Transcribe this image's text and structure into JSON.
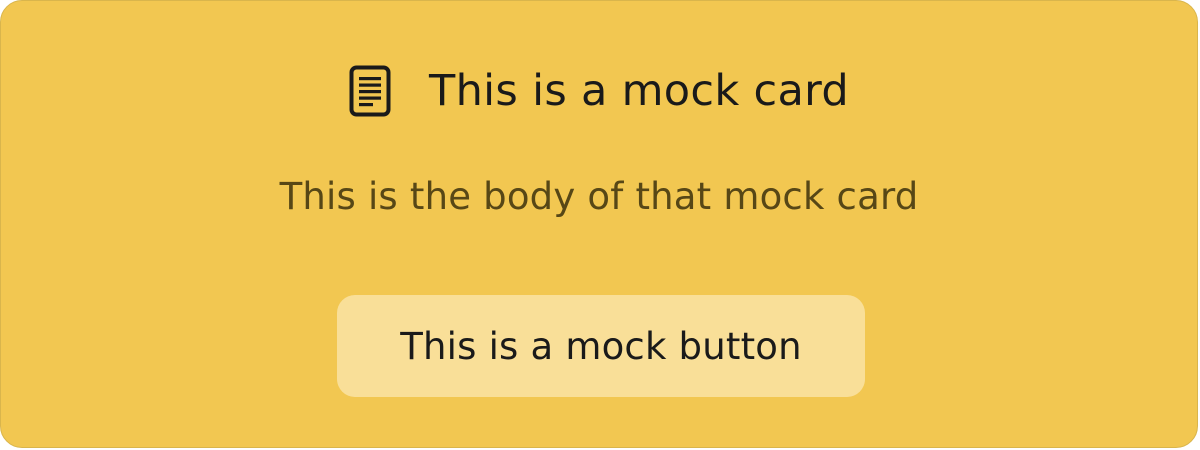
{
  "card": {
    "icon": "document-icon",
    "title": "This is a mock card",
    "body": "This is the body of that mock card",
    "button_label": "This is a mock button"
  },
  "colors": {
    "card_background": "#f2c751",
    "button_background": "#f9df98",
    "title_text": "#1a1a1a",
    "body_text": "#574716"
  }
}
